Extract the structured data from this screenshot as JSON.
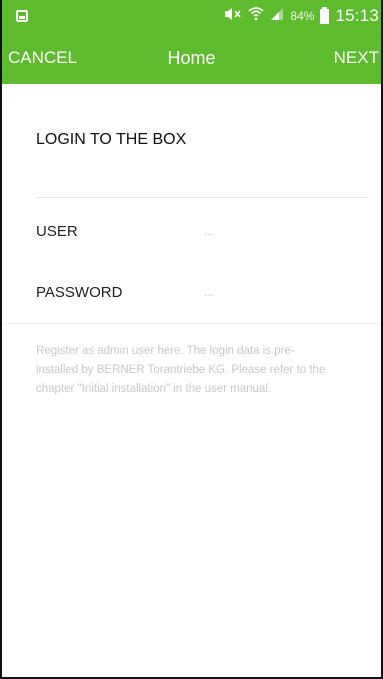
{
  "status_bar": {
    "battery_percent": "84%",
    "time": "15:13",
    "icons": [
      "gallery-icon",
      "mute-icon",
      "wifi-icon",
      "signal-icon",
      "battery-icon"
    ]
  },
  "app_bar": {
    "cancel_label": "CANCEL",
    "title": "Home",
    "next_label": "NEXT",
    "color": "#5fbb2e"
  },
  "login": {
    "section_title": "LOGIN TO THE BOX",
    "fields": [
      {
        "label": "USER",
        "value": "..."
      },
      {
        "label": "PASSWORD",
        "value": "..."
      }
    ],
    "help_text": "Register as admin user here. The login data is pre-installed by BERNER Torantriebe KG. Please refer to the chapter \"Initial installation\" in the user manual."
  }
}
